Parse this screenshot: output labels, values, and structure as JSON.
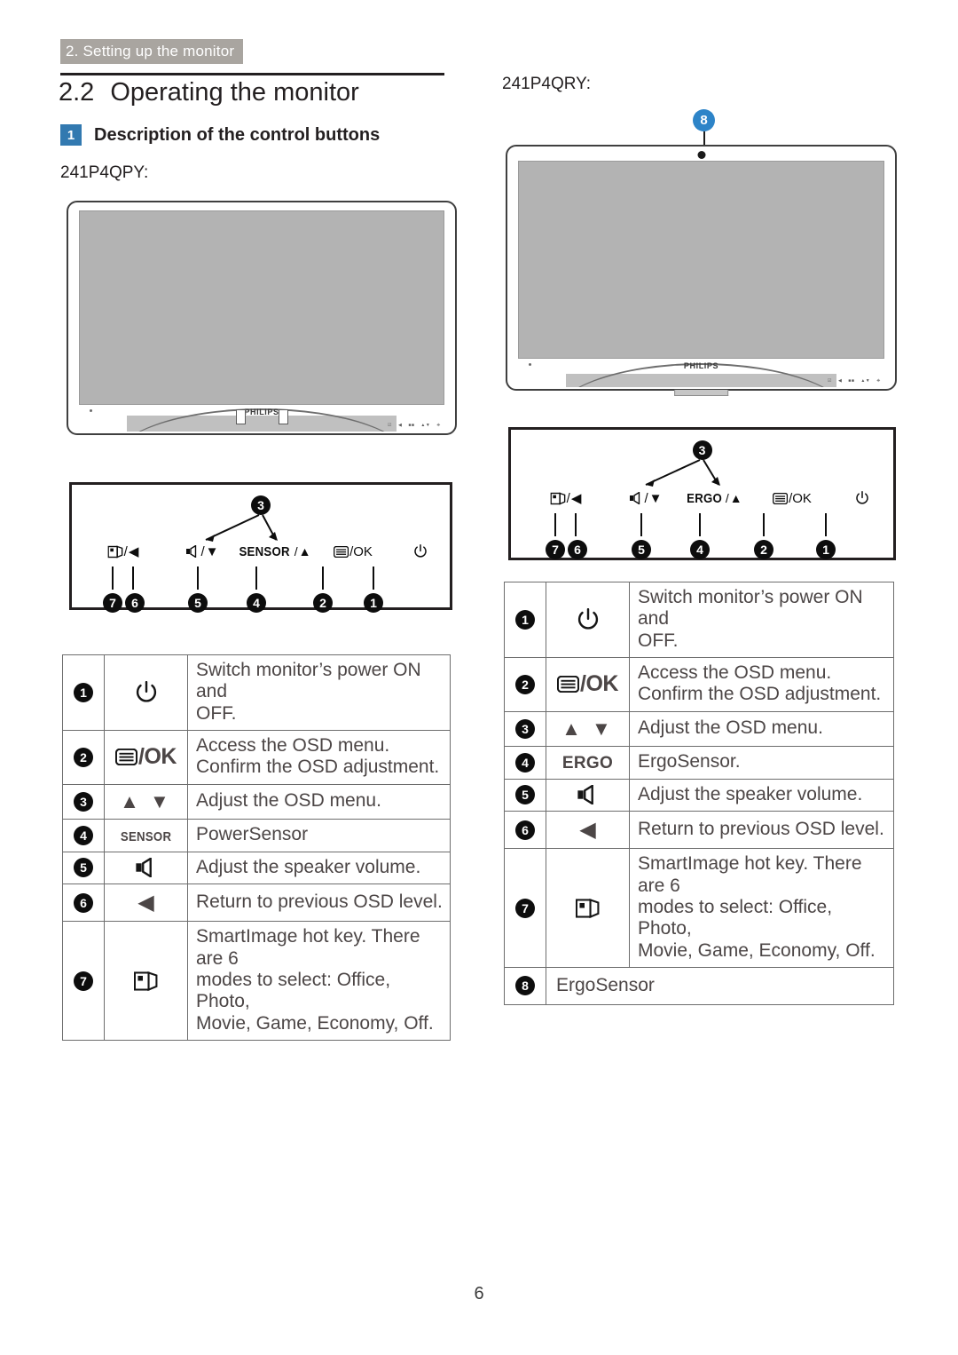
{
  "header": {
    "running_head": "2. Setting up the monitor",
    "section_number": "2.2",
    "section_title": "Operating the monitor",
    "subsection_badge": "1",
    "subsection_title": "Description of the control buttons",
    "accent_blue": "#3279b0",
    "banner_gray": "#a9a5a0"
  },
  "left": {
    "model": "241P4QPY:",
    "monitor": {
      "brand": "PHILIPS",
      "bezel_keys": [
        "☰",
        "◀",
        "■■",
        "▲▼",
        "⏻"
      ]
    },
    "panel": {
      "top_number": "3",
      "icons": [
        "❑/◀",
        "◂⧓/▼",
        "SENSOR/▲",
        "☰/OK",
        "⏻"
      ],
      "numbers": [
        "7",
        "6",
        "5",
        "4",
        "2",
        "1"
      ]
    },
    "table": [
      {
        "num": "1",
        "icon": "power",
        "icon_text": "",
        "lines": [
          "Switch monitor’s power ON and",
          "OFF."
        ]
      },
      {
        "num": "2",
        "icon": "menu-ok",
        "icon_text": "/OK",
        "lines": [
          "Access the OSD menu.",
          "Confirm the OSD adjustment."
        ]
      },
      {
        "num": "3",
        "icon": "up-down",
        "icon_text": "▲ ▼",
        "lines": [
          "Adjust the OSD menu."
        ]
      },
      {
        "num": "4",
        "icon": "sensor-badge",
        "icon_text": "SENSOR",
        "lines": [
          "PowerSensor"
        ]
      },
      {
        "num": "5",
        "icon": "speaker",
        "icon_text": "",
        "lines": [
          "Adjust the speaker volume."
        ]
      },
      {
        "num": "6",
        "icon": "left-arrow",
        "icon_text": "◀",
        "lines": [
          "Return to previous OSD level."
        ]
      },
      {
        "num": "7",
        "icon": "smartimage",
        "icon_text": "",
        "lines": [
          "SmartImage hot key. There are 6",
          "modes to select: Office, Photo,",
          "Movie, Game, Economy, Off."
        ]
      }
    ]
  },
  "right": {
    "model": "241P4QRY:",
    "callout": {
      "number": "8",
      "color": "#2d84c8"
    },
    "monitor": {
      "brand": "PHILIPS",
      "bezel_keys": [
        "☰",
        "◀",
        "■■",
        "▲▼",
        "⏻"
      ]
    },
    "panel": {
      "top_number": "3",
      "icons": [
        "❑/◀",
        "◂⧓/▼",
        "ERGO/▲",
        "☰/OK",
        "⏻"
      ],
      "numbers": [
        "7",
        "6",
        "5",
        "4",
        "2",
        "1"
      ]
    },
    "table": [
      {
        "num": "1",
        "icon": "power",
        "icon_text": "",
        "lines": [
          "Switch monitor’s power ON and",
          "OFF."
        ]
      },
      {
        "num": "2",
        "icon": "menu-ok",
        "icon_text": "/OK",
        "lines": [
          "Access the OSD menu.",
          "Confirm the OSD adjustment."
        ]
      },
      {
        "num": "3",
        "icon": "up-down",
        "icon_text": "▲ ▼",
        "lines": [
          "Adjust the OSD menu."
        ]
      },
      {
        "num": "4",
        "icon": "ergo-badge",
        "icon_text": "ERGO",
        "lines": [
          "ErgoSensor."
        ]
      },
      {
        "num": "5",
        "icon": "speaker",
        "icon_text": "",
        "lines": [
          "Adjust the speaker volume."
        ]
      },
      {
        "num": "6",
        "icon": "left-arrow",
        "icon_text": "◀",
        "lines": [
          "Return to previous OSD level."
        ]
      },
      {
        "num": "7",
        "icon": "smartimage",
        "icon_text": "",
        "lines": [
          "SmartImage hot key. There are 6",
          "modes to select: Office, Photo,",
          "Movie, Game, Economy, Off."
        ]
      },
      {
        "num": "8",
        "icon": "",
        "icon_text": "",
        "lines": [
          "ErgoSensor"
        ],
        "full_width": true
      }
    ]
  },
  "footer": {
    "page_number": "6"
  }
}
